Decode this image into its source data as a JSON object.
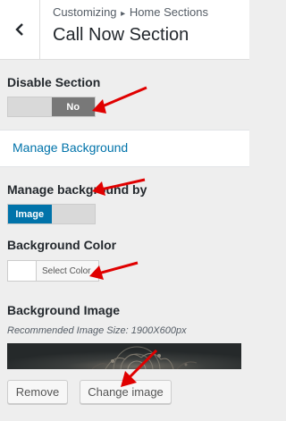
{
  "header": {
    "breadcrumb_parent": "Customizing",
    "breadcrumb_separator": "▸",
    "breadcrumb_section": "Home Sections",
    "title": "Call Now Section"
  },
  "disable_section": {
    "label": "Disable Section",
    "value": "No"
  },
  "manage_background_link": "Manage Background",
  "manage_background_by": {
    "label": "Manage background by",
    "value": "Image"
  },
  "background_color": {
    "label": "Background Color",
    "button_label": "Select Color",
    "value": "#ffffff"
  },
  "background_image": {
    "label": "Background Image",
    "hint": "Recommended Image Size: 1900X600px",
    "remove_label": "Remove",
    "change_label": "Change image"
  },
  "colors": {
    "accent": "#0073aa",
    "toggle_on": "#787878",
    "panel_bg": "#eeeeee",
    "annotation_arrow": "#e00000"
  },
  "icons": {
    "back": "chevron-left-icon",
    "annotation": "red-arrow-icon"
  }
}
